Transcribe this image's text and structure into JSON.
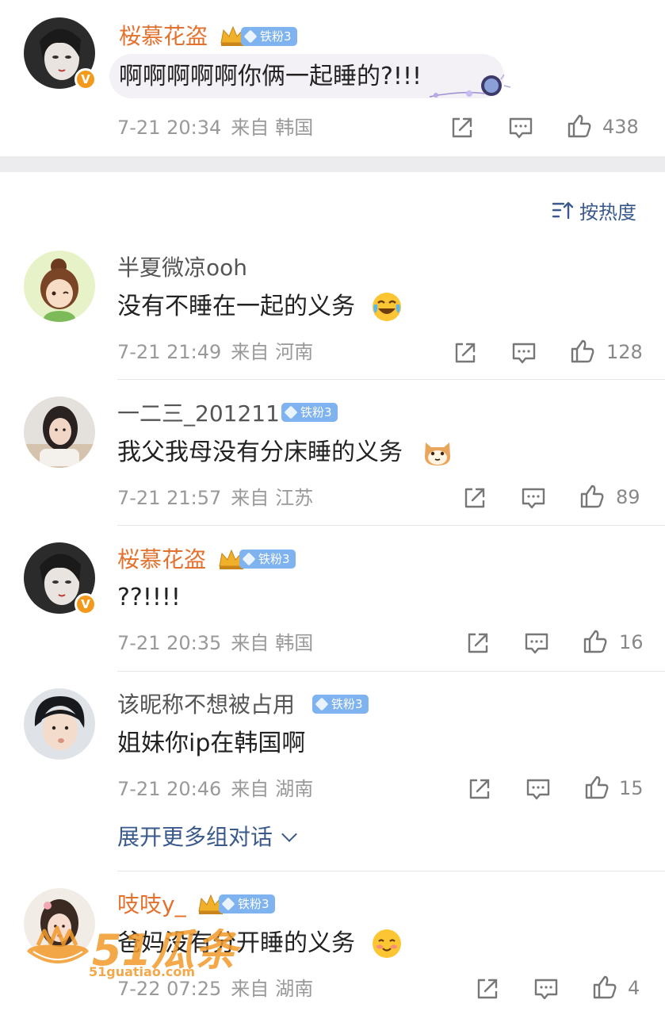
{
  "top_comment": {
    "username": "桜慕花盗",
    "fan_badge": "铁粉3",
    "verified_badge": "V",
    "text": "啊啊啊啊啊你俩一起睡的?!!!",
    "time": "7-21 20:34",
    "from_label": "来自",
    "location": "韩国",
    "likes": "438"
  },
  "sort_label": "按热度",
  "replies": [
    {
      "username": "半夏微凉ooh",
      "fan_badge": "",
      "text": "没有不睡在一起的义务",
      "emoji": "laugh-cry-emoji",
      "time": "7-21 21:49",
      "from_label": "来自",
      "location": "河南",
      "likes": "128"
    },
    {
      "username": "一二三_201211",
      "fan_badge": "铁粉3",
      "text": "我父我母没有分床睡的义务",
      "emoji": "cat-emoji",
      "time": "7-21 21:57",
      "from_label": "来自",
      "location": "江苏",
      "likes": "89"
    },
    {
      "username": "桜慕花盗",
      "fan_badge": "铁粉3",
      "verified_badge": "V",
      "text": "??!!!!",
      "time": "7-21 20:35",
      "from_label": "来自",
      "location": "韩国",
      "likes": "16"
    },
    {
      "username": "该昵称不想被占用",
      "fan_badge": "铁粉3",
      "text": "姐妹你ip在韩国啊",
      "time": "7-21 20:46",
      "from_label": "来自",
      "location": "湖南",
      "likes": "15"
    },
    {
      "username": "吱吱y_",
      "fan_badge": "铁粉3",
      "text": "爸妈没有分开睡的义务",
      "emoji": "shy-smile-emoji",
      "time": "7-22 07:25",
      "from_label": "来自",
      "location": "湖南",
      "likes": "4"
    }
  ],
  "expand_label": "展开更多组对话",
  "watermark": {
    "brand": "51瓜条",
    "site": "51guatiao.com"
  },
  "colors": {
    "accent_orange": "#e4722f",
    "link_blue": "#3a5a8c",
    "fan_badge_blue": "#7fb3ef",
    "meta_gray": "#999999"
  },
  "icons": [
    "share-icon",
    "comment-icon",
    "like-icon",
    "sort-icon",
    "chevron-down-icon",
    "crown-icon",
    "diamond-icon"
  ]
}
